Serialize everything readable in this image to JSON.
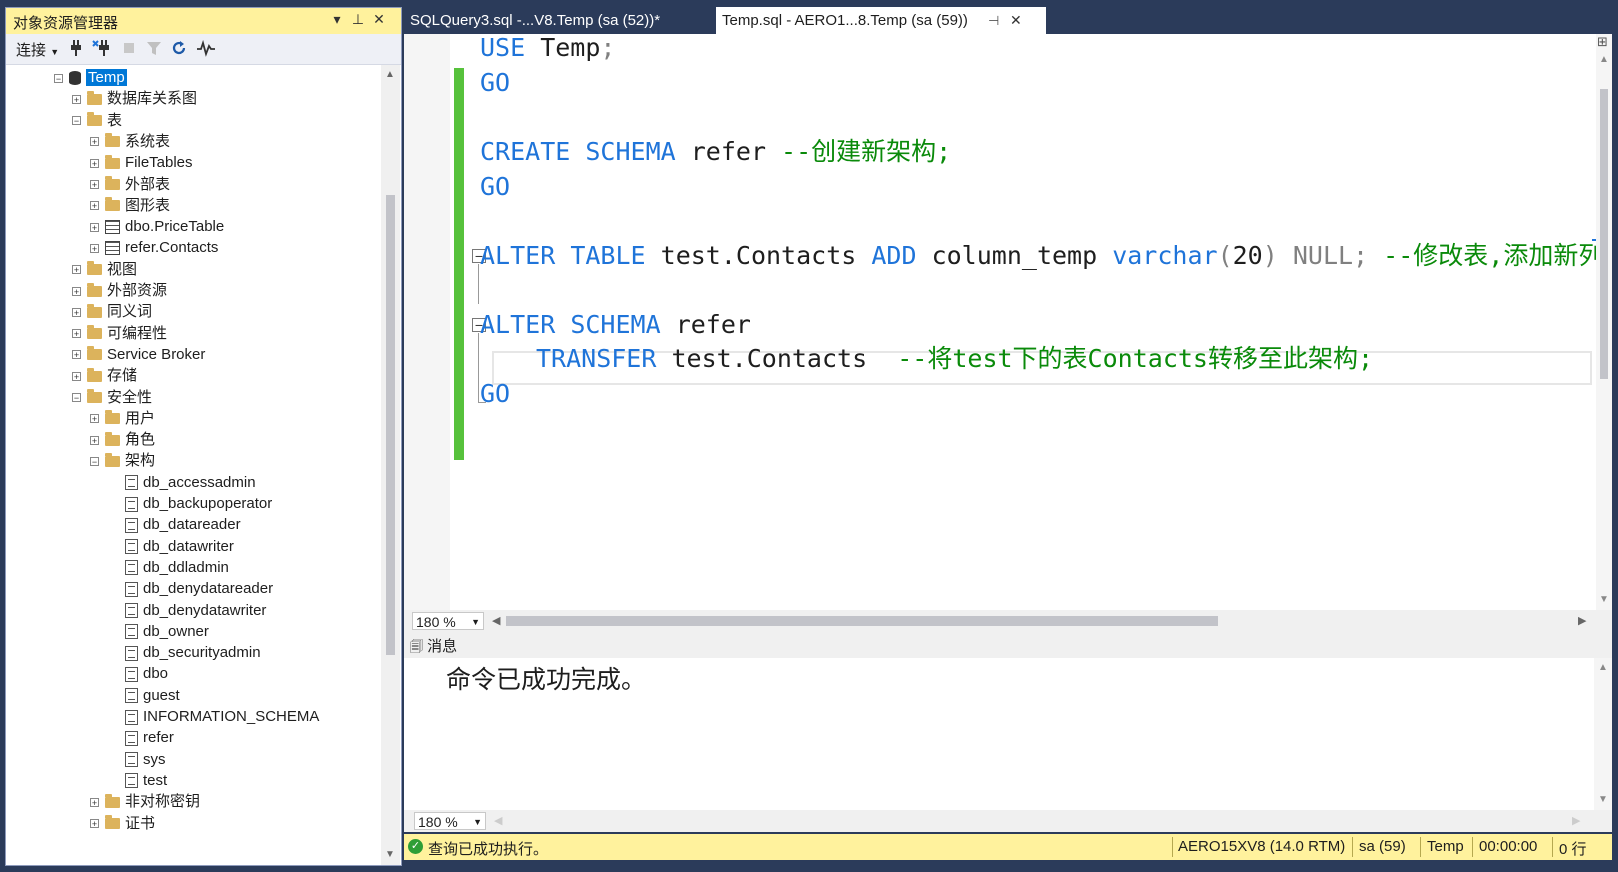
{
  "object_explorer": {
    "title": "对象资源管理器",
    "pin": "▾",
    "dock": "⊥",
    "close": "✕",
    "toolbar": {
      "connect_label": "连接"
    },
    "tree": [
      {
        "label": "Temp",
        "depth": 0,
        "icon": "db",
        "expander": "⊟",
        "selected": true
      },
      {
        "label": "数据库关系图",
        "depth": 1,
        "icon": "folder",
        "expander": "⊞"
      },
      {
        "label": "表",
        "depth": 1,
        "icon": "folder",
        "expander": "⊟"
      },
      {
        "label": "系统表",
        "depth": 2,
        "icon": "folder",
        "expander": "⊞"
      },
      {
        "label": "FileTables",
        "depth": 2,
        "icon": "folder",
        "expander": "⊞"
      },
      {
        "label": "外部表",
        "depth": 2,
        "icon": "folder",
        "expander": "⊞"
      },
      {
        "label": "图形表",
        "depth": 2,
        "icon": "folder",
        "expander": "⊞"
      },
      {
        "label": "dbo.PriceTable",
        "depth": 2,
        "icon": "table",
        "expander": "⊞"
      },
      {
        "label": "refer.Contacts",
        "depth": 2,
        "icon": "table",
        "expander": "⊞"
      },
      {
        "label": "视图",
        "depth": 1,
        "icon": "folder",
        "expander": "⊞"
      },
      {
        "label": "外部资源",
        "depth": 1,
        "icon": "folder",
        "expander": "⊞"
      },
      {
        "label": "同义词",
        "depth": 1,
        "icon": "folder",
        "expander": "⊞"
      },
      {
        "label": "可编程性",
        "depth": 1,
        "icon": "folder",
        "expander": "⊞"
      },
      {
        "label": "Service Broker",
        "depth": 1,
        "icon": "folder",
        "expander": "⊞"
      },
      {
        "label": "存储",
        "depth": 1,
        "icon": "folder",
        "expander": "⊞"
      },
      {
        "label": "安全性",
        "depth": 1,
        "icon": "folder",
        "expander": "⊟"
      },
      {
        "label": "用户",
        "depth": 2,
        "icon": "folder",
        "expander": "⊞"
      },
      {
        "label": "角色",
        "depth": 2,
        "icon": "folder",
        "expander": "⊞"
      },
      {
        "label": "架构",
        "depth": 2,
        "icon": "folder",
        "expander": "⊟"
      },
      {
        "label": "db_accessadmin",
        "depth": 3,
        "icon": "schema",
        "expander": ""
      },
      {
        "label": "db_backupoperator",
        "depth": 3,
        "icon": "schema",
        "expander": ""
      },
      {
        "label": "db_datareader",
        "depth": 3,
        "icon": "schema",
        "expander": ""
      },
      {
        "label": "db_datawriter",
        "depth": 3,
        "icon": "schema",
        "expander": ""
      },
      {
        "label": "db_ddladmin",
        "depth": 3,
        "icon": "schema",
        "expander": ""
      },
      {
        "label": "db_denydatareader",
        "depth": 3,
        "icon": "schema",
        "expander": ""
      },
      {
        "label": "db_denydatawriter",
        "depth": 3,
        "icon": "schema",
        "expander": ""
      },
      {
        "label": "db_owner",
        "depth": 3,
        "icon": "schema",
        "expander": ""
      },
      {
        "label": "db_securityadmin",
        "depth": 3,
        "icon": "schema",
        "expander": ""
      },
      {
        "label": "dbo",
        "depth": 3,
        "icon": "schema",
        "expander": ""
      },
      {
        "label": "guest",
        "depth": 3,
        "icon": "schema",
        "expander": ""
      },
      {
        "label": "INFORMATION_SCHEMA",
        "depth": 3,
        "icon": "schema",
        "expander": ""
      },
      {
        "label": "refer",
        "depth": 3,
        "icon": "schema",
        "expander": ""
      },
      {
        "label": "sys",
        "depth": 3,
        "icon": "schema",
        "expander": ""
      },
      {
        "label": "test",
        "depth": 3,
        "icon": "schema",
        "expander": ""
      },
      {
        "label": "非对称密钥",
        "depth": 2,
        "icon": "folder",
        "expander": "⊞"
      },
      {
        "label": "证书",
        "depth": 2,
        "icon": "folder",
        "expander": "⊞"
      }
    ]
  },
  "tabs": [
    {
      "label": "SQLQuery3.sql -...V8.Temp (sa (52))*",
      "active": false
    },
    {
      "label": "Temp.sql - AERO1...8.Temp (sa (59))",
      "active": true,
      "pin": "⊣",
      "close": "✕"
    }
  ],
  "editor": {
    "line1": {
      "kw": "USE",
      "tx": " Temp",
      "p": ";"
    },
    "line2": {
      "kw": "GO"
    },
    "line3": {
      "kw1": "CREATE",
      "kw2": "SCHEMA",
      "tx": " refer ",
      "cm": "--创建新架构;"
    },
    "line4": {
      "kw": "GO"
    },
    "line5": {
      "kw1": "ALTER",
      "kw2": "TABLE",
      "tx1": " test.Contacts ",
      "kw3": "ADD",
      "tx2": " column_temp ",
      "kw4": "varchar",
      "p1": "(",
      "tx3": "20",
      "p2": ") ",
      "gy": "NULL;",
      "cm": " --修改表,添加新列"
    },
    "line6": {
      "kw1": "ALTER",
      "kw2": "SCHEMA",
      "tx": " refer"
    },
    "line7": {
      "kw": "TRANSFER",
      "tx": " test.Contacts  ",
      "cm": "--将test下的表Contacts转移至此架构;"
    },
    "line8": {
      "kw": "GO"
    },
    "fold_minus": "−",
    "zoom": "180 %"
  },
  "messages": {
    "tab_label": "消息",
    "text": "命令已成功完成。",
    "zoom": "180 %"
  },
  "status": {
    "message": "查询已成功执行。",
    "server": "AERO15XV8 (14.0 RTM)",
    "user": "sa (59)",
    "database": "Temp",
    "elapsed": "00:00:00",
    "rows": "0 行"
  },
  "colors": {
    "keyword": "#1f74d9",
    "comment": "#0a8a0a",
    "status_bar": "#fff29d",
    "change_bar": "#57c23c",
    "selection": "#0078d7"
  }
}
